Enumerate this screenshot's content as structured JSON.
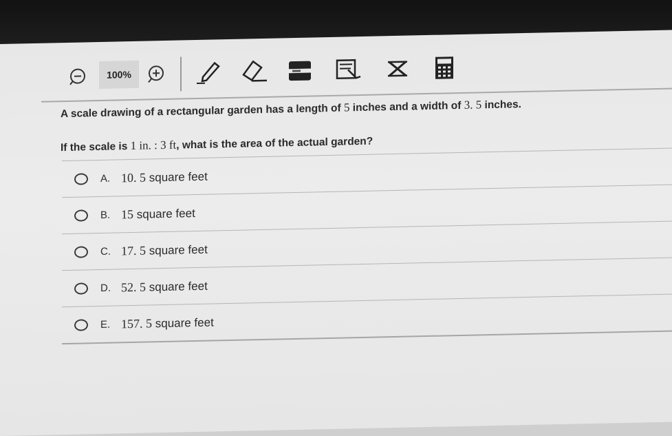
{
  "toolbar": {
    "zoom_out_icon": "zoom-out-icon",
    "zoom_value": "100%",
    "zoom_in_icon": "zoom-in-icon",
    "tools": [
      "pencil-icon",
      "eraser-icon",
      "line-reader-icon",
      "answer-masking-icon",
      "cross-off-icon",
      "calculator-icon"
    ]
  },
  "question": {
    "line1_prefix": "A scale drawing of a rectangular garden has a length of ",
    "length": "5",
    "line1_mid": " inches and a width of ",
    "width": "3. 5",
    "line1_suffix": " inches.",
    "line2_prefix": "If the scale is ",
    "scale": "1 in. : 3 ft",
    "line2_suffix": ", what is the area of the actual garden?"
  },
  "answers": [
    {
      "letter": "A.",
      "number": "10. 5",
      "unit": "square feet"
    },
    {
      "letter": "B.",
      "number": "15",
      "unit": "square feet"
    },
    {
      "letter": "C.",
      "number": "17. 5",
      "unit": "square feet"
    },
    {
      "letter": "D.",
      "number": "52. 5",
      "unit": "square feet"
    },
    {
      "letter": "E.",
      "number": "157. 5",
      "unit": "square feet"
    }
  ]
}
